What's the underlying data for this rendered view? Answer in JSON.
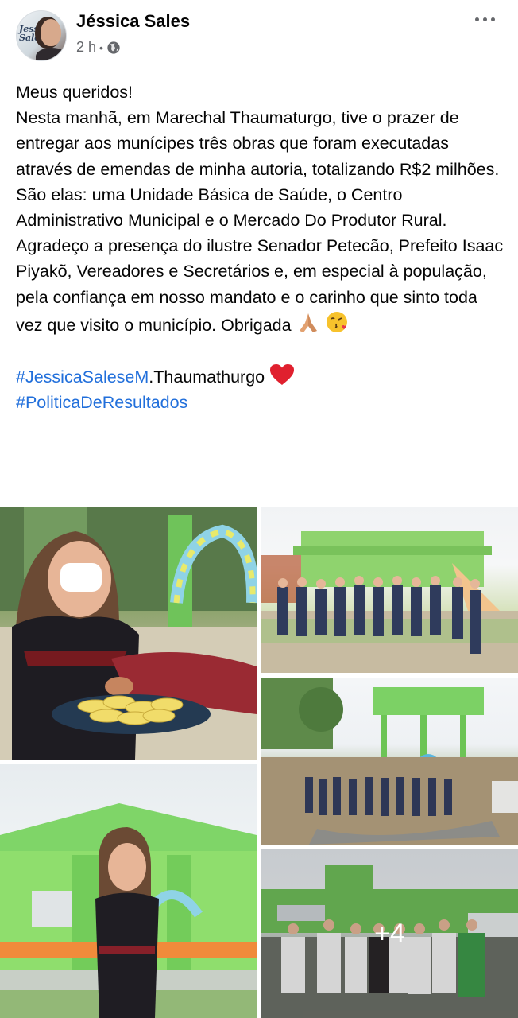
{
  "post": {
    "author": "Jéssica Sales",
    "time": "2 h",
    "separator": "•",
    "avatar_text": "Jessica Sales",
    "icons": {
      "more": "more-options-icon",
      "privacy": "globe-icon",
      "pray": "folded-hands-emoji",
      "kiss": "face-blowing-kiss-emoji",
      "heart": "red-heart-emoji"
    },
    "text": {
      "line1": "Meus queridos!",
      "line2": "Nesta manhã, em Marechal Thaumaturgo, tive o prazer de entregar aos munícipes três obras que foram executadas através de emendas de minha autoria, totalizando R$2 milhões.",
      "line3": "São elas: uma Unidade Básica de Saúde, o Centro Administrativo Municipal e o Mercado Do Produtor Rural.",
      "line4": "Agradeço a presença do ilustre Senador Petecão, Prefeito Isaac Piyakõ, Vereadores e Secretários e, em especial à população, pela confiança em nosso mandato e o carinho que sinto toda vez que visito o município. Obrigada",
      "hashtag1": "#JessicaSaleseM",
      "hashtag1_rest": ".Thaumathurgo",
      "hashtag2": "#PoliticaDeResultados"
    },
    "more_photos": "+4"
  },
  "colors": {
    "link": "#216fdb",
    "meta": "#65676b",
    "text": "#050505"
  }
}
